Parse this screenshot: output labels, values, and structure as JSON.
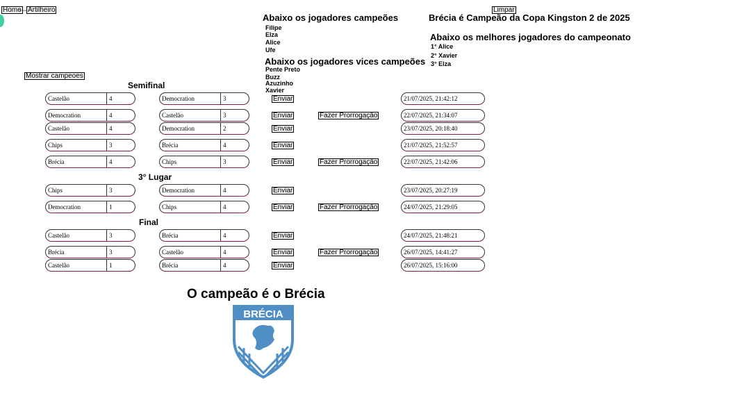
{
  "nav": {
    "home": "Home",
    "separator": "----",
    "artilheiro": "Artilheiro",
    "limpar": "Limpar"
  },
  "champions_header": "Abaixo os jogadores campeões",
  "champions": [
    "Filipe",
    "Elza",
    "Alice",
    "Ufe"
  ],
  "vices_header": "Abaixo os jogadores vices campeões",
  "vices": [
    "Pente Preto",
    "Buzz",
    "Azuzinho",
    "Xavier"
  ],
  "headline": "Brécia é Campeão da Copa Kingston 2 de 2025",
  "best_header": "Abaixo os melhores jogadores do campeonato",
  "best": [
    "1° Alice",
    "2° Xavier",
    "3° Elza"
  ],
  "show_button": "Mostrar campeoes",
  "send_label": "Enviar",
  "overtime_label": "Fazer Prorrogação",
  "sections": [
    {
      "title": "Semifinal",
      "matches": [
        {
          "home": "Castelão",
          "hs": "4",
          "away": "Democration",
          "as": "3",
          "overtime": false,
          "date": "21/07/2025, 21:42:12"
        },
        {
          "home": "Democration",
          "hs": "4",
          "away": "Castelão",
          "as": "3",
          "overtime": true,
          "date": "22/07/2025, 21:34:07"
        },
        {
          "home": "Castelão",
          "hs": "4",
          "away": "Democration",
          "as": "2",
          "overtime": false,
          "date": "23/07/2025, 20:18:40"
        },
        {
          "home": "Chips",
          "hs": "3",
          "away": "Brécia",
          "as": "4",
          "overtime": false,
          "date": "21/07/2025, 21:52:57"
        },
        {
          "home": "Brécia",
          "hs": "4",
          "away": "Chips",
          "as": "3",
          "overtime": true,
          "date": "22/07/2025, 21:42:06"
        }
      ]
    },
    {
      "title": "3° Lugar",
      "matches": [
        {
          "home": "Chips",
          "hs": "3",
          "away": "Democration",
          "as": "4",
          "overtime": false,
          "date": "23/07/2025, 20:27:19"
        },
        {
          "home": "Democration",
          "hs": "1",
          "away": "Chips",
          "as": "4",
          "overtime": true,
          "date": "24/07/2025, 21:29:05"
        }
      ]
    },
    {
      "title": "Final",
      "matches": [
        {
          "home": "Castelão",
          "hs": "3",
          "away": "Brécia",
          "as": "4",
          "overtime": false,
          "date": "24/07/2025, 21:48:21"
        },
        {
          "home": "Brécia",
          "hs": "3",
          "away": "Castelão",
          "as": "4",
          "overtime": true,
          "date": "26/07/2025, 14:41:27"
        },
        {
          "home": "Castelão",
          "hs": "1",
          "away": "Brécia",
          "as": "4",
          "overtime": false,
          "date": "26/07/2025, 15:16:00"
        }
      ]
    }
  ],
  "champion_text": "O campeão é o Brécia",
  "logo_text": "BRÉCIA",
  "colors": {
    "logo_blue": "#4f8fc6",
    "dot_green": "#3fd39b",
    "field_border": "#8a1a4a"
  }
}
